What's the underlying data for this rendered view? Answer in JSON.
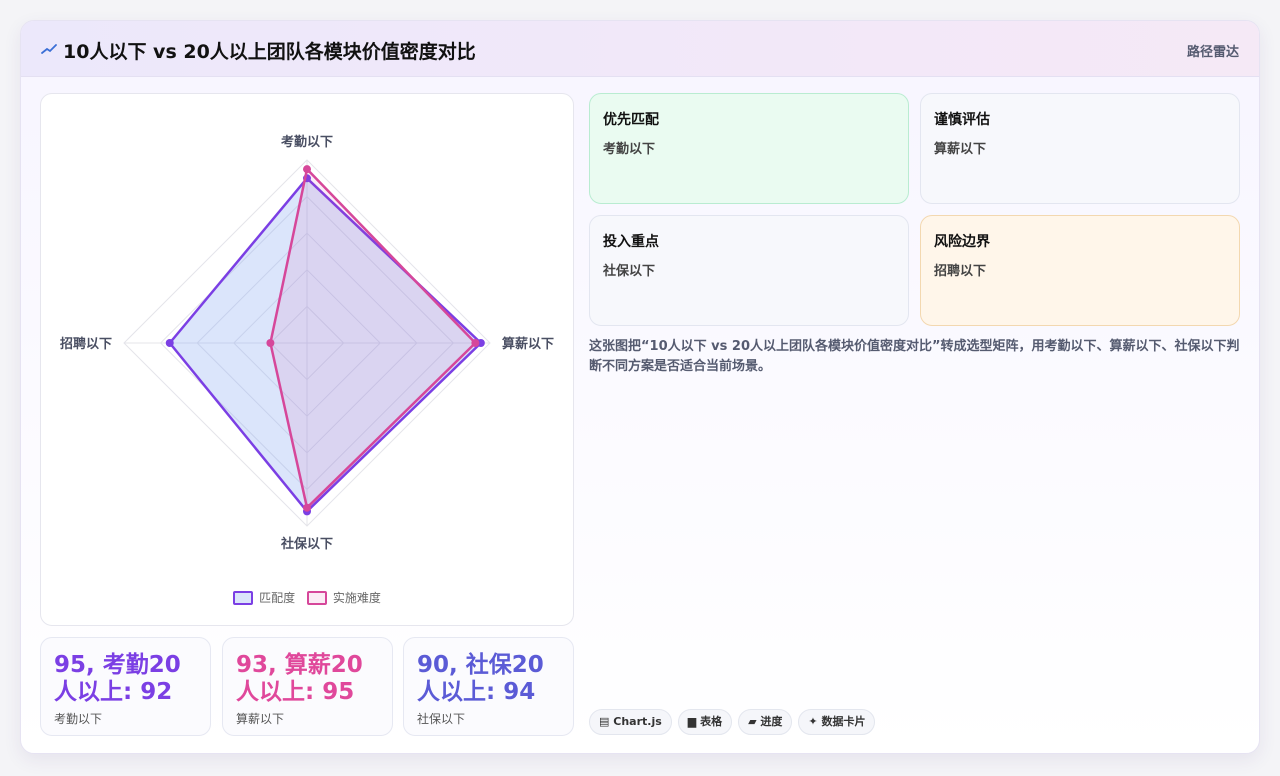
{
  "header": {
    "title": "10人以下 vs 20人以上团队各模块价值密度对比",
    "tag": "路径雷达",
    "logo_icon": "trend-line-icon"
  },
  "chart_data": {
    "type": "radar",
    "categories": [
      "考勤以下",
      "算薪以下",
      "社保以下",
      "招聘以下"
    ],
    "series": [
      {
        "name": "匹配度",
        "values": [
          90,
          95,
          92,
          75
        ],
        "color": "#7b3fe4",
        "fill": "rgba(125,160,240,0.28)"
      },
      {
        "name": "实施难度",
        "values": [
          95,
          92,
          90,
          20
        ],
        "color": "#d6479a",
        "fill": "rgba(214,71,154,0.10)"
      }
    ],
    "r_range": [
      0,
      100
    ],
    "rings": 5,
    "legend_position": "bottom"
  },
  "stats": [
    {
      "value": "95, 考勤20人以上: 92",
      "label": "考勤以下",
      "color": "#7b3fe4"
    },
    {
      "value": "93, 算薪20人以上: 95",
      "label": "算薪以下",
      "color": "#e0489b"
    },
    {
      "value": "90, 社保20人以上: 94",
      "label": "社保以下",
      "color": "#5b5bd6"
    }
  ],
  "tiles": [
    {
      "title": "优先匹配",
      "sub": "考勤以下"
    },
    {
      "title": "谨慎评估",
      "sub": "算薪以下"
    },
    {
      "title": "投入重点",
      "sub": "社保以下"
    },
    {
      "title": "风险边界",
      "sub": "招聘以下"
    }
  ],
  "description": "这张图把“10人以下 vs 20人以上团队各模块价值密度对比”转成选型矩阵，用考勤以下、算薪以下、社保以下判断不同方案是否适合当前场景。",
  "chips": [
    {
      "icon": "chart-icon",
      "glyph": "▤",
      "label": "Chart.js"
    },
    {
      "icon": "table-icon",
      "glyph": "▆",
      "label": "表格"
    },
    {
      "icon": "progress-icon",
      "glyph": "▰",
      "label": "进度"
    },
    {
      "icon": "sparkle-icon",
      "glyph": "✦",
      "label": "数据卡片"
    }
  ]
}
